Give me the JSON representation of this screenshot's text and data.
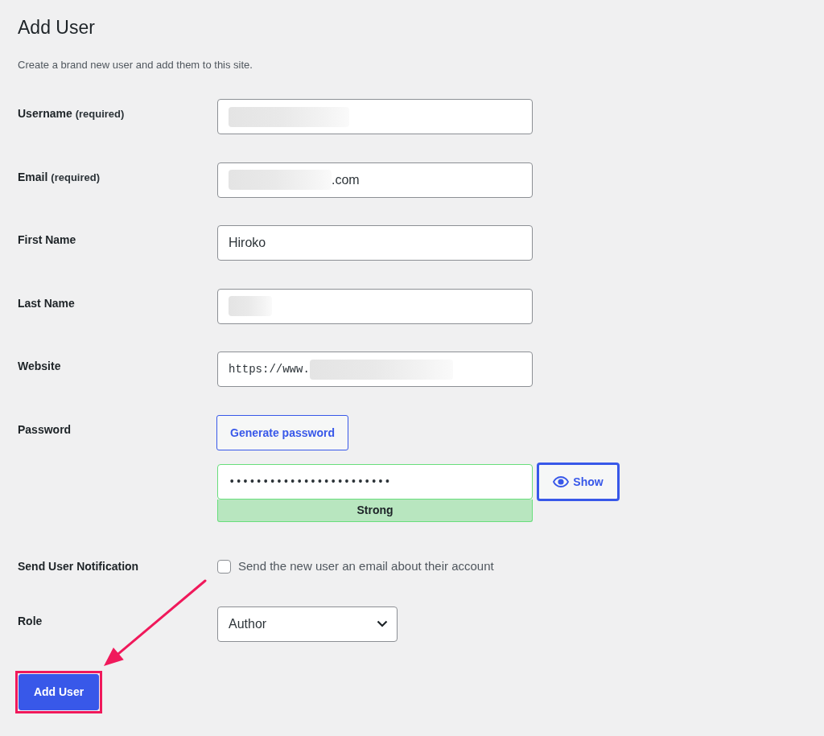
{
  "page": {
    "title": "Add User",
    "description": "Create a brand new user and add them to this site."
  },
  "fields": [
    {
      "kind": "text",
      "label": "Username",
      "note": "(required)",
      "value_parts": [
        {
          "kind": "redacted"
        }
      ]
    },
    {
      "kind": "text",
      "label": "Email",
      "note": "(required)",
      "value_parts": [
        {
          "kind": "redacted"
        },
        {
          "kind": "text",
          "text": ".com"
        }
      ]
    },
    {
      "kind": "text",
      "label": "First Name",
      "value_parts": [
        {
          "kind": "text",
          "text": "Hiroko"
        }
      ]
    },
    {
      "kind": "text",
      "label": "Last Name",
      "value_parts": [
        {
          "kind": "redacted"
        }
      ]
    },
    {
      "kind": "url",
      "label": "Website",
      "value_parts": [
        {
          "kind": "text",
          "text": "https://www."
        },
        {
          "kind": "redacted"
        }
      ]
    },
    {
      "kind": "password",
      "label": "Password",
      "generate_button": "Generate password",
      "value": "••••••••••••••••••••••••",
      "strength": {
        "kind": "strong",
        "label": "Strong"
      },
      "toggle": {
        "label": "Show",
        "focused": true
      }
    },
    {
      "kind": "checkbox",
      "label": "Send User Notification",
      "checked": false,
      "text": "Send the new user an email about their account"
    },
    {
      "kind": "select",
      "label": "Role",
      "value": "Author"
    }
  ],
  "submit": {
    "label": "Add User",
    "highlighted": true
  },
  "annotation": {
    "pointer_arrow": true
  }
}
